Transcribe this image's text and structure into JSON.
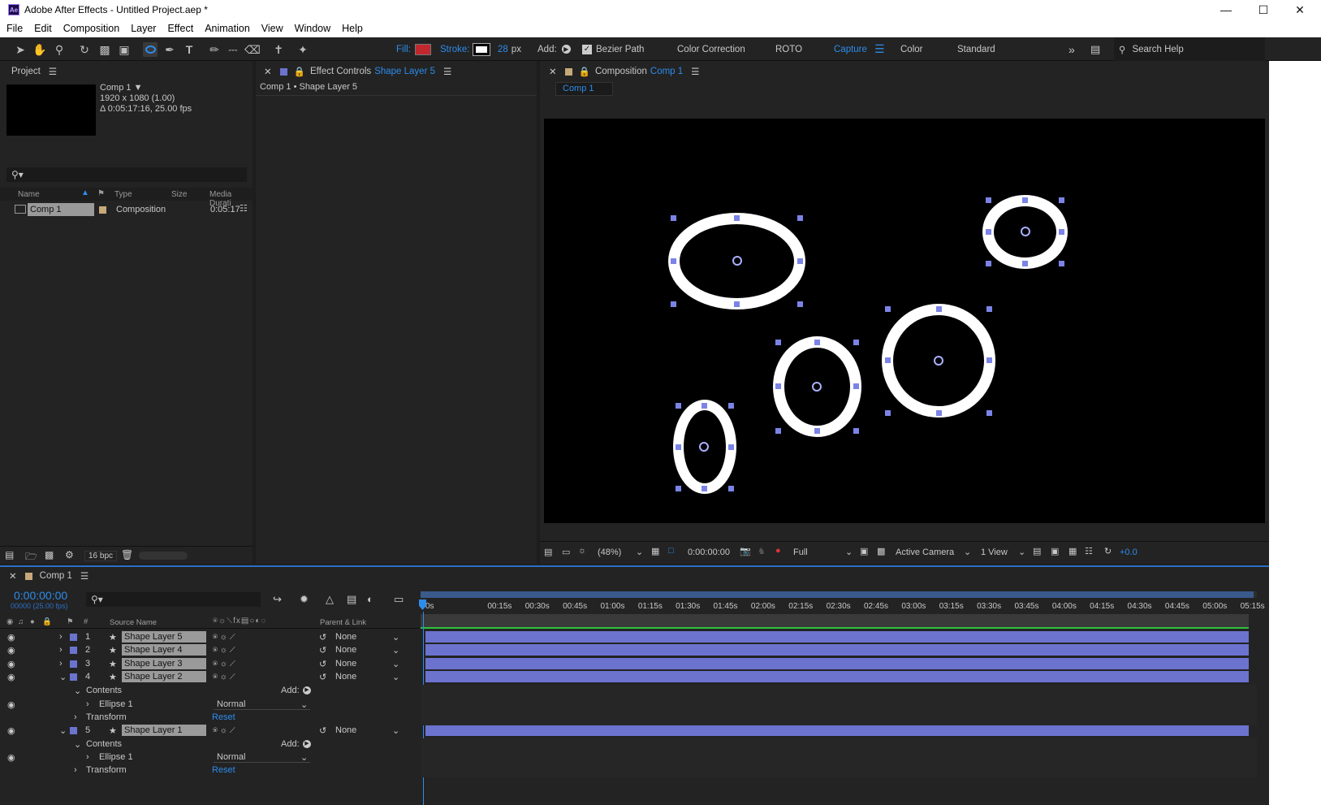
{
  "app": {
    "title": "Adobe After Effects - Untitled Project.aep *",
    "logo_text": "Ae"
  },
  "menu": [
    "File",
    "Edit",
    "Composition",
    "Layer",
    "Effect",
    "Animation",
    "View",
    "Window",
    "Help"
  ],
  "toolbar": {
    "fill_label": "Fill:",
    "stroke_label": "Stroke:",
    "stroke_width": "28",
    "stroke_unit": "px",
    "add_label": "Add:",
    "bezier_label": "Bezier Path",
    "workspaces": [
      "Color Correction",
      "ROTO",
      "Capture",
      "Color",
      "Standard"
    ],
    "active_workspace": "Capture",
    "search_placeholder": "Search Help",
    "fill_color": "#c0282d",
    "accent": "#2d8ceb"
  },
  "project_panel": {
    "title": "Project",
    "comp_name": "Comp 1",
    "comp_res": "1920 x 1080 (1.00)",
    "comp_dur": "Δ 0:05:17:16, 25.00 fps",
    "columns": [
      "Name",
      "Type",
      "Size",
      "Media Durati"
    ],
    "items": [
      {
        "name": "Comp 1",
        "type": "Composition",
        "duration": "0:05:17"
      }
    ],
    "bpc": "16 bpc"
  },
  "effect_controls": {
    "title": "Effect Controls",
    "layer": "Shape Layer 5",
    "breadcrumb": "Comp 1 • Shape Layer 5"
  },
  "composition_panel": {
    "title": "Composition",
    "comp": "Comp 1",
    "tab": "Comp 1",
    "zoom": "(48%)",
    "timecode": "0:00:00:00",
    "resolution": "Full",
    "camera": "Active Camera",
    "views": "1 View",
    "exposure": "+0.0"
  },
  "timeline": {
    "tab": "Comp 1",
    "timecode": "0:00:00:00",
    "frame_info": "00000 (25.00 fps)",
    "columns": {
      "source_name": "Source Name",
      "parent": "Parent & Link"
    },
    "ruler": [
      "0s",
      "00:15s",
      "00:30s",
      "00:45s",
      "01:00s",
      "01:15s",
      "01:30s",
      "01:45s",
      "02:00s",
      "02:15s",
      "02:30s",
      "02:45s",
      "03:00s",
      "03:15s",
      "03:30s",
      "03:45s",
      "04:00s",
      "04:15s",
      "04:30s",
      "04:45s",
      "05:00s",
      "05:15s"
    ],
    "layers": [
      {
        "num": "1",
        "name": "Shape Layer 5",
        "parent": "None"
      },
      {
        "num": "2",
        "name": "Shape Layer 4",
        "parent": "None"
      },
      {
        "num": "3",
        "name": "Shape Layer 3",
        "parent": "None"
      },
      {
        "num": "4",
        "name": "Shape Layer 2",
        "parent": "None"
      },
      {
        "num": "5",
        "name": "Shape Layer 1",
        "parent": "None"
      }
    ],
    "sub": {
      "contents": "Contents",
      "add": "Add:",
      "ellipse": "Ellipse 1",
      "blend": "Normal",
      "transform": "Transform",
      "reset": "Reset"
    }
  }
}
